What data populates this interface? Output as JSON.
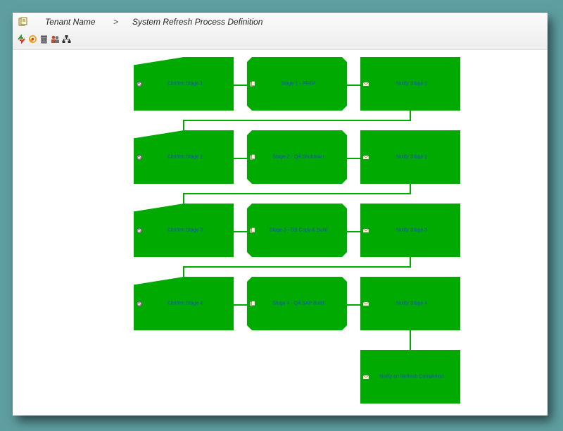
{
  "header": {
    "tenant": "Tenant Name",
    "separator": ">",
    "page_title": "System Refresh Process Definition"
  },
  "toolbar": {
    "tools": [
      "refresh-icon",
      "reload-icon",
      "delete-icon",
      "users-icon",
      "hierarchy-icon"
    ]
  },
  "process": {
    "rows": [
      {
        "confirm": "Confirm Stage 1",
        "stage": "Stage 1 - PREP",
        "notify": "Notify Stage 1"
      },
      {
        "confirm": "Confirm Stage 2",
        "stage": "Stage 2 - QA Shutdown",
        "notify": "Notify Stage 2"
      },
      {
        "confirm": "Confirm Stage 3",
        "stage": "Stage 3 - DB Copy & Build",
        "notify": "Notify Stage 3"
      },
      {
        "confirm": "Confirm Stage 4",
        "stage": "Stage 4 - QA SAP Build",
        "notify": "Notify Stage 4"
      }
    ],
    "final": "Notify on Refresh Completion"
  },
  "colors": {
    "node": "#00aa00",
    "label": "#1a4fc8",
    "background": "#5f9ea0"
  }
}
